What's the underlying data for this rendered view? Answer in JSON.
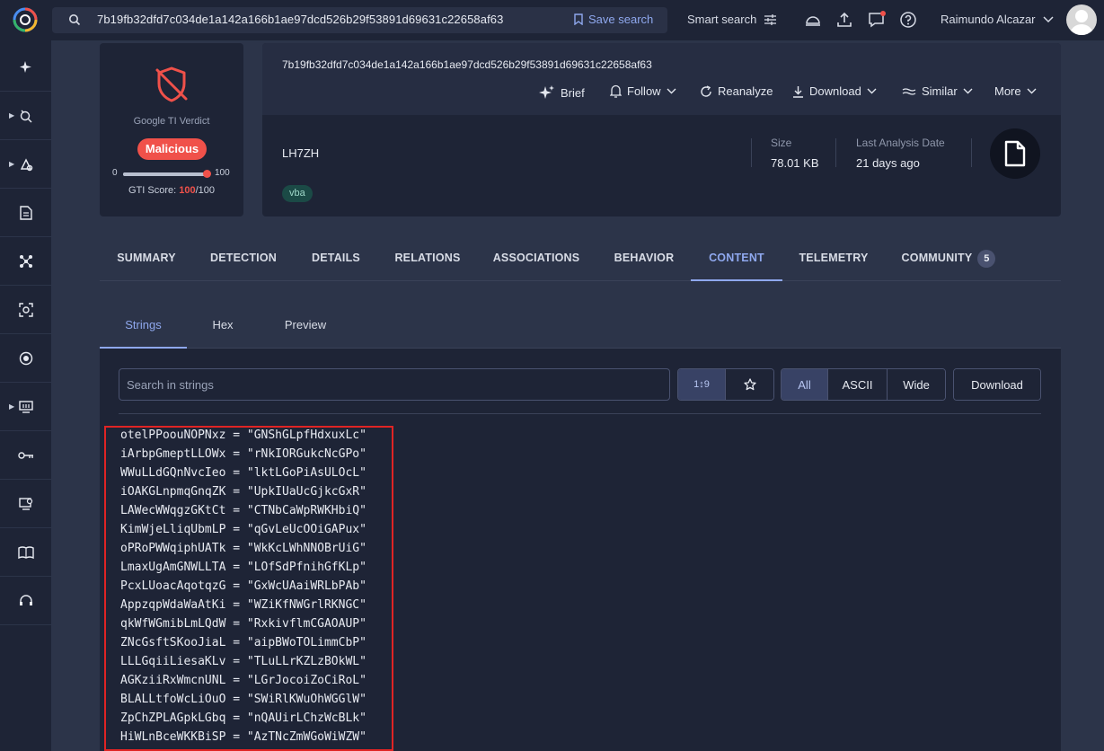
{
  "topbar": {
    "search_query": "7b19fb32dfd7c034de1a142a166b1ae97dcd526b29f53891d69631c22658af63",
    "save_search_label": "Save search",
    "smart_search_label": "Smart search",
    "user_name": "Raimundo Alcazar",
    "notification_dot_color": "#f0514a"
  },
  "sidebar": {
    "items": [
      {
        "icon": "sparkle-icon",
        "has_caret": false
      },
      {
        "icon": "threat-hunt-icon",
        "has_caret": true
      },
      {
        "icon": "intel-icon",
        "has_caret": true
      },
      {
        "icon": "report-icon",
        "has_caret": false
      },
      {
        "icon": "graph-icon",
        "has_caret": false
      },
      {
        "icon": "scan-icon",
        "has_caret": false
      },
      {
        "icon": "record-icon",
        "has_caret": false
      },
      {
        "icon": "monitor-icon",
        "has_caret": true
      },
      {
        "icon": "key-icon",
        "has_caret": false
      },
      {
        "icon": "device-icon",
        "has_caret": false
      },
      {
        "icon": "book-icon",
        "has_caret": false
      },
      {
        "icon": "support-icon",
        "has_caret": false
      }
    ]
  },
  "verdict": {
    "label": "Google TI Verdict",
    "badge": "Malicious",
    "slider_min": "0",
    "slider_max": "100",
    "score_prefix": "GTI Score: ",
    "score": "100",
    "score_suffix": "/100",
    "score_fraction": 1.0,
    "accent_color": "#f0514a"
  },
  "file": {
    "hash": "7b19fb32dfd7c034de1a142a166b1ae97dcd526b29f53891d69631c22658af63",
    "name": "LH7ZH",
    "tag": "vba",
    "size_label": "Size",
    "size_value": "78.01 KB",
    "last_analysis_label": "Last Analysis Date",
    "last_analysis_value": "21 days ago"
  },
  "actions": {
    "brief": "Brief",
    "follow": "Follow",
    "reanalyze": "Reanalyze",
    "download": "Download",
    "similar": "Similar",
    "more": "More"
  },
  "tabs": [
    {
      "label": "SUMMARY"
    },
    {
      "label": "DETECTION"
    },
    {
      "label": "DETAILS"
    },
    {
      "label": "RELATIONS"
    },
    {
      "label": "ASSOCIATIONS"
    },
    {
      "label": "BEHAVIOR"
    },
    {
      "label": "CONTENT",
      "active": true
    },
    {
      "label": "TELEMETRY"
    },
    {
      "label": "COMMUNITY",
      "count": "5"
    }
  ],
  "subtabs": [
    {
      "label": "Strings",
      "active": true
    },
    {
      "label": "Hex"
    },
    {
      "label": "Preview"
    }
  ],
  "strings_toolbar": {
    "search_placeholder": "Search in strings",
    "sort_label": "1↕9",
    "filter_all": "All",
    "filter_ascii": "ASCII",
    "filter_wide": "Wide",
    "download": "Download"
  },
  "strings": [
    "otelPPoouNOPNxz = \"GNShGLpfHdxuxLc\"",
    "iArbpGmeptLLOWx = \"rNkIORGukcNcGPo\"",
    "WWuLLdGQnNvcIeo = \"lktLGoPiAsULOcL\"",
    "iOAKGLnpmqGnqZK = \"UpkIUaUcGjkcGxR\"",
    "LAWecWWqgzGKtCt = \"CTNbCaWpRWKHbiQ\"",
    "KimWjeLliqUbmLP = \"qGvLeUcOOiGAPux\"",
    "oPRoPWWqiphUATk = \"WkKcLWhNNOBrUiG\"",
    "LmaxUgAmGNWLLTA = \"LOfSdPfnihGfKLp\"",
    "PcxLUoacAqotqzG = \"GxWcUAaiWRLbPAb\"",
    "AppzqpWdaWaAtKi = \"WZiKfNWGrlRKNGC\"",
    "qkWfWGmibLmLQdW = \"RxkivflmCGAOAUP\"",
    "ZNcGsftSKooJiaL = \"aipBWoTOLimmCbP\"",
    "LLLGqiiLiesaKLv = \"TLuLLrKZLzBOkWL\"",
    "AGKziiRxWmcnUNL = \"LGrJocoiZoCiRoL\"",
    "BLALLtfoWcLiOuO = \"SWiRlKWuOhWGGlW\"",
    "ZpChZPLAGpkLGbq = \"nQAUirLChzWcBLk\"",
    "HiWLnBceWKKBiSP = \"AzTNcZmWGoWiWZW\""
  ]
}
